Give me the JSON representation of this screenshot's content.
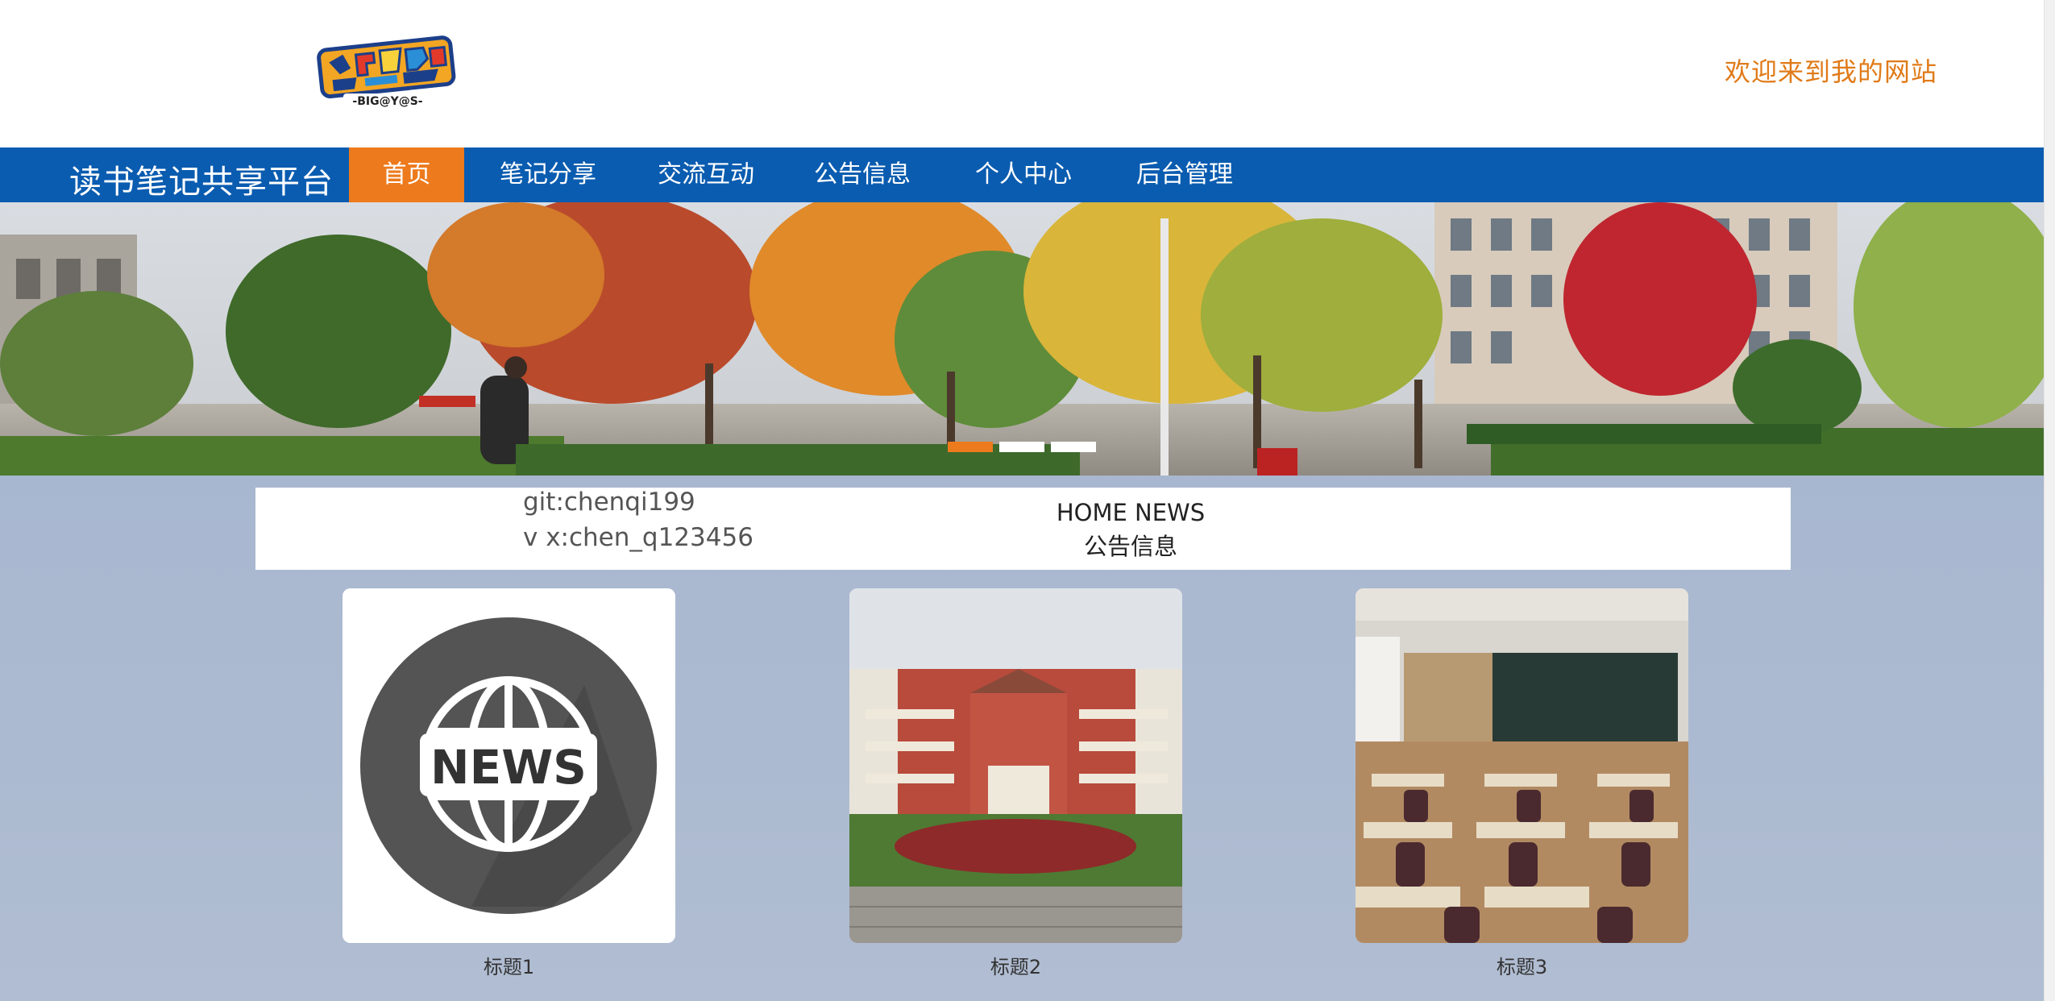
{
  "header": {
    "logo_text": "-BIG@Y@S-",
    "welcome": "欢迎来到我的网站"
  },
  "nav": {
    "brand": "读书笔记共享平台",
    "items": [
      {
        "label": "首页",
        "active": true
      },
      {
        "label": "笔记分享",
        "active": false
      },
      {
        "label": "交流互动",
        "active": false
      },
      {
        "label": "公告信息",
        "active": false
      },
      {
        "label": "个人中心",
        "active": false
      },
      {
        "label": "后台管理",
        "active": false
      }
    ]
  },
  "banner": {
    "slides": 3,
    "active_slide": 1
  },
  "info": {
    "git": "git:chenqi199",
    "vx": "v x:chen_q123456",
    "section_title": "HOME NEWS",
    "section_subtitle": "公告信息"
  },
  "cards": [
    {
      "title": "标题1",
      "image": "news-globe-icon"
    },
    {
      "title": "标题2",
      "image": "school-building-photo"
    },
    {
      "title": "标题3",
      "image": "classroom-photo"
    }
  ],
  "colors": {
    "nav_bg": "#0a5cb0",
    "accent": "#ed7a1c",
    "welcome": "#e07a18",
    "page_bg": "#a7b6cf"
  }
}
